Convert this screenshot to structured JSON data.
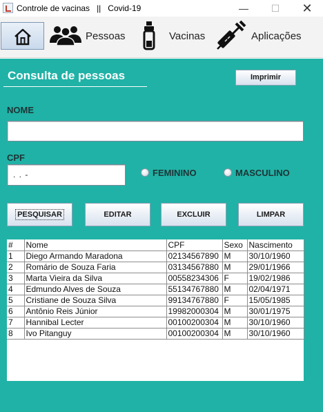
{
  "window": {
    "title": "Controle de vacinas   ||   Covid-19",
    "minimize": "—",
    "maximize": "☐",
    "close": "✕"
  },
  "toolbar": {
    "items": [
      {
        "label": "",
        "icon": "home-icon"
      },
      {
        "label": "Pessoas",
        "icon": "people-icon"
      },
      {
        "label": "Vacinas",
        "icon": "vaccine-vial-icon"
      },
      {
        "label": "Aplicações",
        "icon": "syringe-icon"
      }
    ]
  },
  "main": {
    "title": "Consulta de pessoas",
    "print_button": "Imprimir",
    "nome_label": "NOME",
    "nome_value": "",
    "cpf_label": "CPF",
    "cpf_value": " .  .  -",
    "radio_female": "FEMININO",
    "radio_male": "MASCULINO",
    "buttons": {
      "pesquisar": "PESQUISAR",
      "editar": "EDITAR",
      "excluir": "EXCLUIR",
      "limpar": "LIMPAR"
    }
  },
  "table": {
    "columns": [
      "#",
      "Nome",
      "CPF",
      "Sexo",
      "Nascimento"
    ],
    "rows": [
      [
        "1",
        "Diego Armando Maradona",
        "02134567890",
        "M",
        "30/10/1960"
      ],
      [
        "2",
        "Romário de Souza Faria",
        "03134567880",
        "M",
        "29/01/1966"
      ],
      [
        "3",
        "Marta Vieira da Silva",
        "00558234306",
        "F",
        "19/02/1986"
      ],
      [
        "4",
        "Edmundo Alves de Souza",
        "55134767880",
        "M",
        "02/04/1971"
      ],
      [
        "5",
        "Cristiane de Souza Silva",
        "99134767880",
        "F",
        "15/05/1985"
      ],
      [
        "6",
        "Antônio Reis Júnior",
        "19982000304",
        "M",
        "30/01/1975"
      ],
      [
        "7",
        "Hannibal Lecter",
        "00100200304",
        "M",
        "30/10/1960"
      ],
      [
        "8",
        "Ivo Pitanguy",
        "00100200304",
        "M",
        "30/10/1960"
      ]
    ]
  },
  "colors": {
    "panel": "#20b2a6",
    "title_text": "#ffffff",
    "label_text": "#1e3436"
  }
}
